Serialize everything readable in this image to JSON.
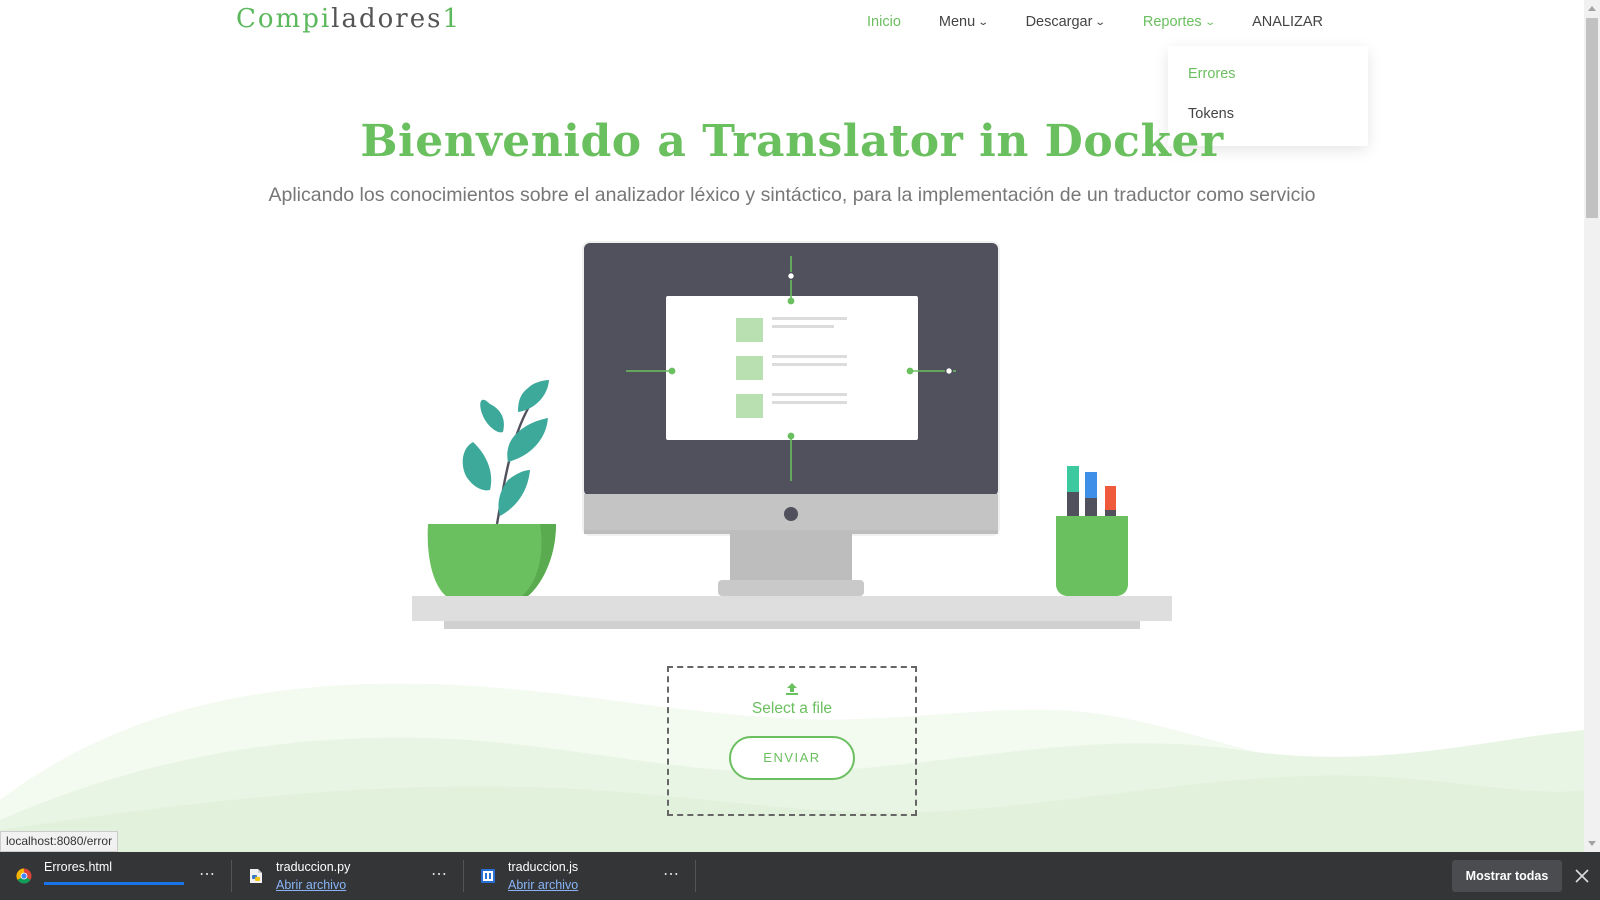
{
  "brand": {
    "part1": "Compi",
    "part2": "ladores",
    "part3": "1"
  },
  "nav": {
    "items": [
      {
        "label": "Inicio",
        "active": true,
        "has_dropdown": false
      },
      {
        "label": "Menu",
        "active": false,
        "has_dropdown": true
      },
      {
        "label": "Descargar",
        "active": false,
        "has_dropdown": true
      },
      {
        "label": "Reportes",
        "active": true,
        "has_dropdown": true
      },
      {
        "label": "ANALIZAR",
        "active": false,
        "has_dropdown": false
      }
    ],
    "chevron": "⌄",
    "dropdown": {
      "items": [
        {
          "label": "Errores",
          "active": true
        },
        {
          "label": "Tokens",
          "active": false
        }
      ]
    }
  },
  "hero": {
    "title": "Bienvenido a Translator in Docker",
    "subtitle": "Aplicando los conocimientos sobre el analizador léxico y sintáctico, para la implementación de un traductor como servicio"
  },
  "upload": {
    "select_label": "Select a file",
    "submit_label": "ENVIAR",
    "icon": "upload-icon"
  },
  "status_url": "localhost:8080/error",
  "downloads": {
    "items": [
      {
        "name": "Errores.html",
        "link": "",
        "icon": "chrome-icon",
        "in_progress": true
      },
      {
        "name": "traduccion.py",
        "link": "Abrir archivo",
        "icon": "python-file-icon",
        "in_progress": false
      },
      {
        "name": "traduccion.js",
        "link": "Abrir archivo",
        "icon": "js-file-icon",
        "in_progress": false
      }
    ],
    "more_label": "⋯",
    "show_all_label": "Mostrar todas"
  },
  "colors": {
    "accent": "#6abf5e",
    "text": "#444444",
    "shelf_bg": "#333537",
    "monitor_dark": "#50515d",
    "hill_light": "#eef7ea"
  }
}
